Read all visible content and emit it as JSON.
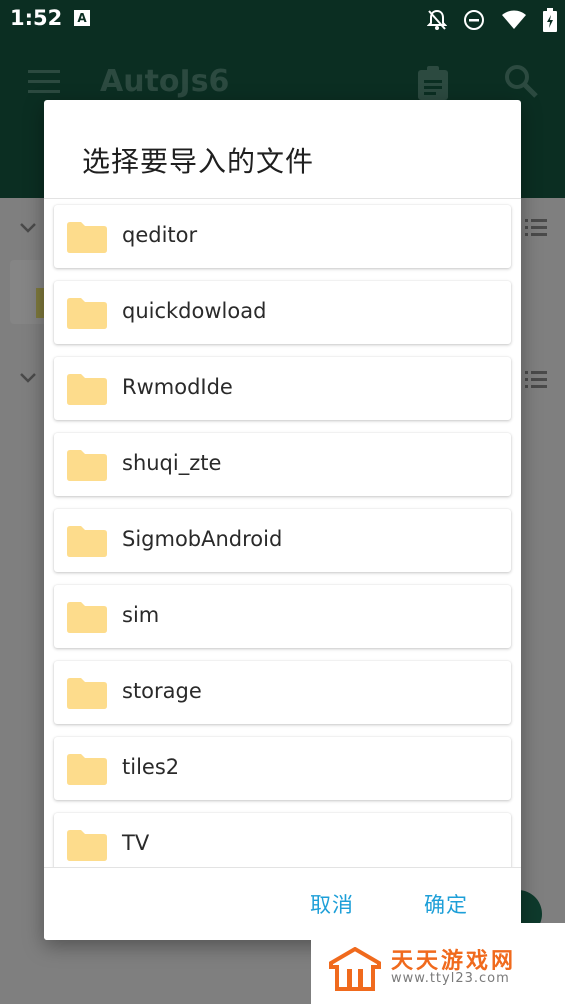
{
  "status_bar": {
    "time": "1:52",
    "notification_letter": "A"
  },
  "app_bar": {
    "title": "AutoJs6"
  },
  "dialog": {
    "title": "选择要导入的文件",
    "files": [
      {
        "name": "qeditor"
      },
      {
        "name": "quickdowload"
      },
      {
        "name": "RwmodIde"
      },
      {
        "name": "shuqi_zte"
      },
      {
        "name": "SigmobAndroid"
      },
      {
        "name": "sim"
      },
      {
        "name": "storage"
      },
      {
        "name": "tiles2"
      },
      {
        "name": "TV"
      }
    ],
    "cancel_label": "取消",
    "ok_label": "确定"
  },
  "watermark": {
    "name": "天天游戏网",
    "url": "www.ttyl23.com"
  },
  "colors": {
    "app_bar": "#0b2e22",
    "accent": "#1d9fd8",
    "folder": "#fddc8c",
    "watermark": "#f06a1d"
  },
  "icons": [
    "menu-icon",
    "clipboard-icon",
    "search-icon",
    "folder-icon",
    "chevron-down-icon",
    "list-view-icon",
    "wifi-icon",
    "battery-icon",
    "do-not-disturb-icon",
    "notifications-off-icon"
  ]
}
